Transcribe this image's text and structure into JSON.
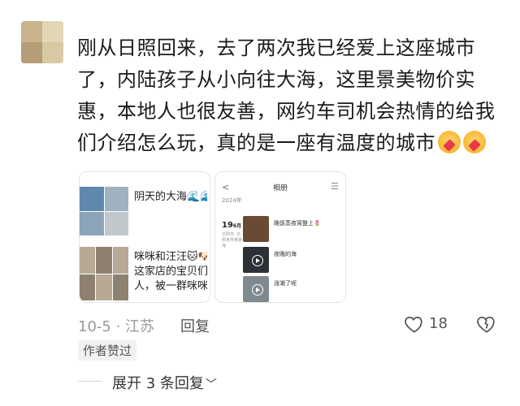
{
  "comment": {
    "text": "刚从日照回来，去了两次我已经爱上这座城市了，内陆孩子从小向往大海，这里景美物价实惠，本地人也很友善，网约车司机会热情的给我们介绍怎么玩，真的是一座有温度的城市"
  },
  "card1": {
    "item1_text": "阴天的大海🌊🌊",
    "item2_line1": "咪咪和汪汪🐱🐶",
    "item2_line2": "这家店的宝贝们特",
    "item2_line3": "人，被一群咪咪和"
  },
  "card2": {
    "title": "相册",
    "year": "2024年",
    "date": "19",
    "date_suffix": "6月",
    "sub": "日照市· 日照世界美景海",
    "entry1": "晚饭蒸夜宵整上🌷",
    "entry2": "夜晚的海",
    "entry3": "涨潮了呢"
  },
  "meta": {
    "date_location": "10-5 · 江苏",
    "reply_label": "回复",
    "like_count": "18",
    "author_badge": "作者赞过",
    "expand_label": "展开 3 条回复"
  },
  "colors": {
    "text": "#1a1a1a",
    "muted": "#9a9a9a",
    "badge_bg": "#f1f1f1"
  }
}
